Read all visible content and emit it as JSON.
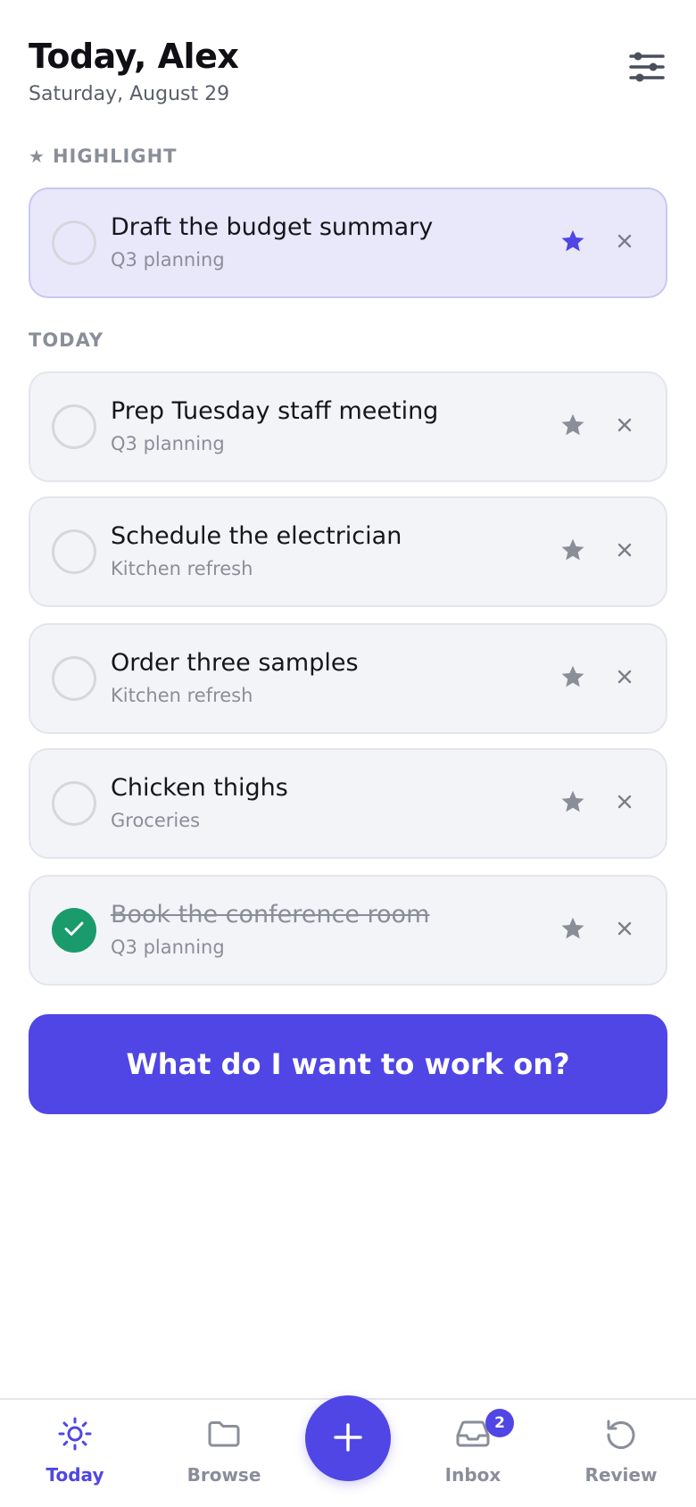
{
  "header": {
    "title": "Today, Alex",
    "date": "Saturday, August 29",
    "filter_icon": "sliders-icon"
  },
  "highlight_section": {
    "label": "HIGHLIGHT",
    "icon": "star-icon",
    "task": {
      "title": "Draft the budget summary",
      "project": "Q3 planning",
      "starred": true,
      "done": false
    }
  },
  "today_section": {
    "label": "TODAY",
    "tasks": [
      {
        "title": "Prep Tuesday staff meeting",
        "project": "Q3 planning",
        "starred": false,
        "done": false
      },
      {
        "title": "Schedule the electrician",
        "project": "Kitchen refresh",
        "starred": false,
        "done": false
      },
      {
        "title": "Order three samples",
        "project": "Kitchen refresh",
        "starred": false,
        "done": false
      },
      {
        "title": "Chicken thighs",
        "project": "Groceries",
        "starred": false,
        "done": false
      },
      {
        "title": "Book the conference room",
        "project": "Q3 planning",
        "starred": false,
        "done": true
      }
    ]
  },
  "cta": {
    "label": "What do I want to work on?"
  },
  "nav": {
    "items": [
      {
        "label": "Today",
        "icon": "sun-icon",
        "active": true
      },
      {
        "label": "Browse",
        "icon": "folder-icon",
        "active": false
      },
      {
        "label": "Inbox",
        "icon": "inbox-icon",
        "active": false,
        "badge": "2"
      },
      {
        "label": "Review",
        "icon": "refresh-icon",
        "active": false
      }
    ],
    "fab_icon": "plus-icon"
  },
  "colors": {
    "accent": "#4f46e5",
    "done_green": "#1a9b6b",
    "highlight_bg": "#e9e8fb",
    "card_bg": "#f3f4f8",
    "muted": "#8a8e99"
  }
}
